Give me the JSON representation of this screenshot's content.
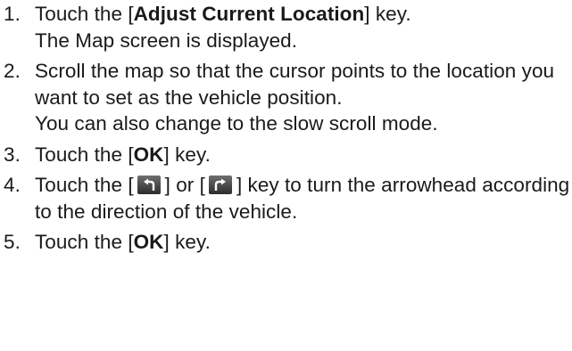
{
  "steps": [
    {
      "number": "1.",
      "pre": "Touch the [",
      "key": "Adjust Current Location",
      "post": "] key.",
      "note": "The Map screen is displayed."
    },
    {
      "number": "2.",
      "text": "Scroll the map so that the cursor points to the location you want to set as the vehicle position.",
      "note": "You can also change to the slow scroll mode."
    },
    {
      "number": "3.",
      "pre": "Touch the [",
      "key": "OK",
      "post": "] key."
    },
    {
      "number": "4.",
      "part1": "Touch the [",
      "left_icon": "turn-left-icon",
      "part2": "] or [",
      "right_icon": "turn-right-icon",
      "part3": "] key to turn the arrowhead according to the direction of the vehicle."
    },
    {
      "number": "5.",
      "pre": "Touch the [",
      "key": "OK",
      "post": "] key."
    }
  ]
}
